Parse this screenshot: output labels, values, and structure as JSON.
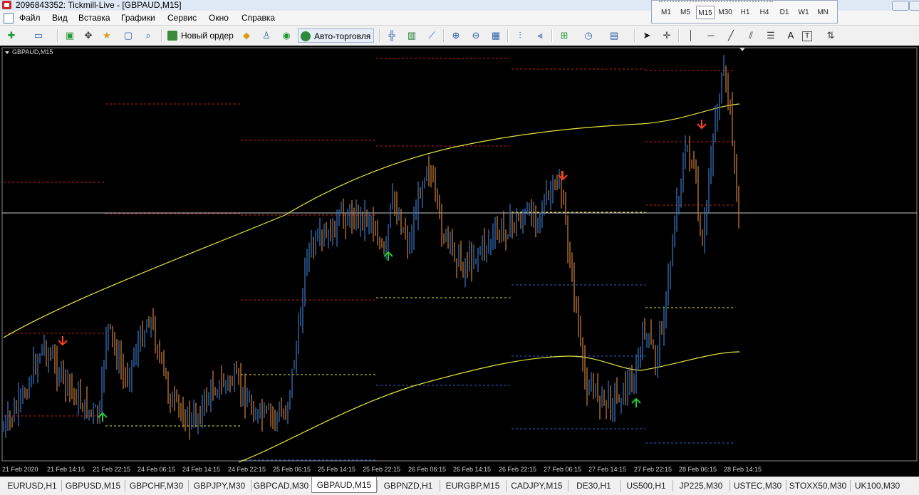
{
  "window": {
    "title": "2096843352: Tickmill-Live - [GBPAUD,M15]"
  },
  "menu": [
    "Файл",
    "Вид",
    "Вставка",
    "Графики",
    "Сервис",
    "Окно",
    "Справка"
  ],
  "timeframes": [
    "M1",
    "M5",
    "M15",
    "M30",
    "H1",
    "H4",
    "D1",
    "W1",
    "MN"
  ],
  "active_timeframe": "M15",
  "toolbar": {
    "new_order": "Новый ордер",
    "auto_trading": "Авто-торговля",
    "text_tool": "A",
    "text_label_tool": "T"
  },
  "chart": {
    "symbol_label": "GBPAUD,M15",
    "x_labels": [
      "21 Feb 2020",
      "21 Feb 14:15",
      "21 Feb 22:15",
      "24 Feb 06:15",
      "24 Feb 14:15",
      "24 Feb 22:15",
      "25 Feb 06:15",
      "25 Feb 14:15",
      "25 Feb 22:15",
      "26 Feb 06:15",
      "26 Feb 14:15",
      "26 Feb 22:15",
      "27 Feb 06:15",
      "27 Feb 14:15",
      "27 Feb 22:15",
      "28 Feb 06:15",
      "28 Feb 14:15"
    ],
    "colors": {
      "background": "#000000",
      "bull_bar": "#3a78c8",
      "bear_bar": "#d2813a",
      "envelope": "#e4e43a",
      "resistance": "#c81e1e",
      "support": "#2f62c8",
      "pivot": "#e4e43a",
      "current_price": "#c8c8c8",
      "up_arrow": "#28c83c",
      "down_arrow": "#ff4020"
    }
  },
  "tabs": [
    "EURUSD,H1",
    "GBPUSD,M15",
    "GBPCHF,M30",
    "GBPJPY,M30",
    "GBPCAD,M30",
    "GBPAUD,M15",
    "GBPNZD,H1",
    "EURGBP,M15",
    "CADJPY,M15",
    "DE30,H1",
    "US500,H1",
    "JP225,M30",
    "USTEC,M30",
    "STOXX50,M30",
    "UK100,M30"
  ],
  "active_tab": "GBPAUD,M15"
}
